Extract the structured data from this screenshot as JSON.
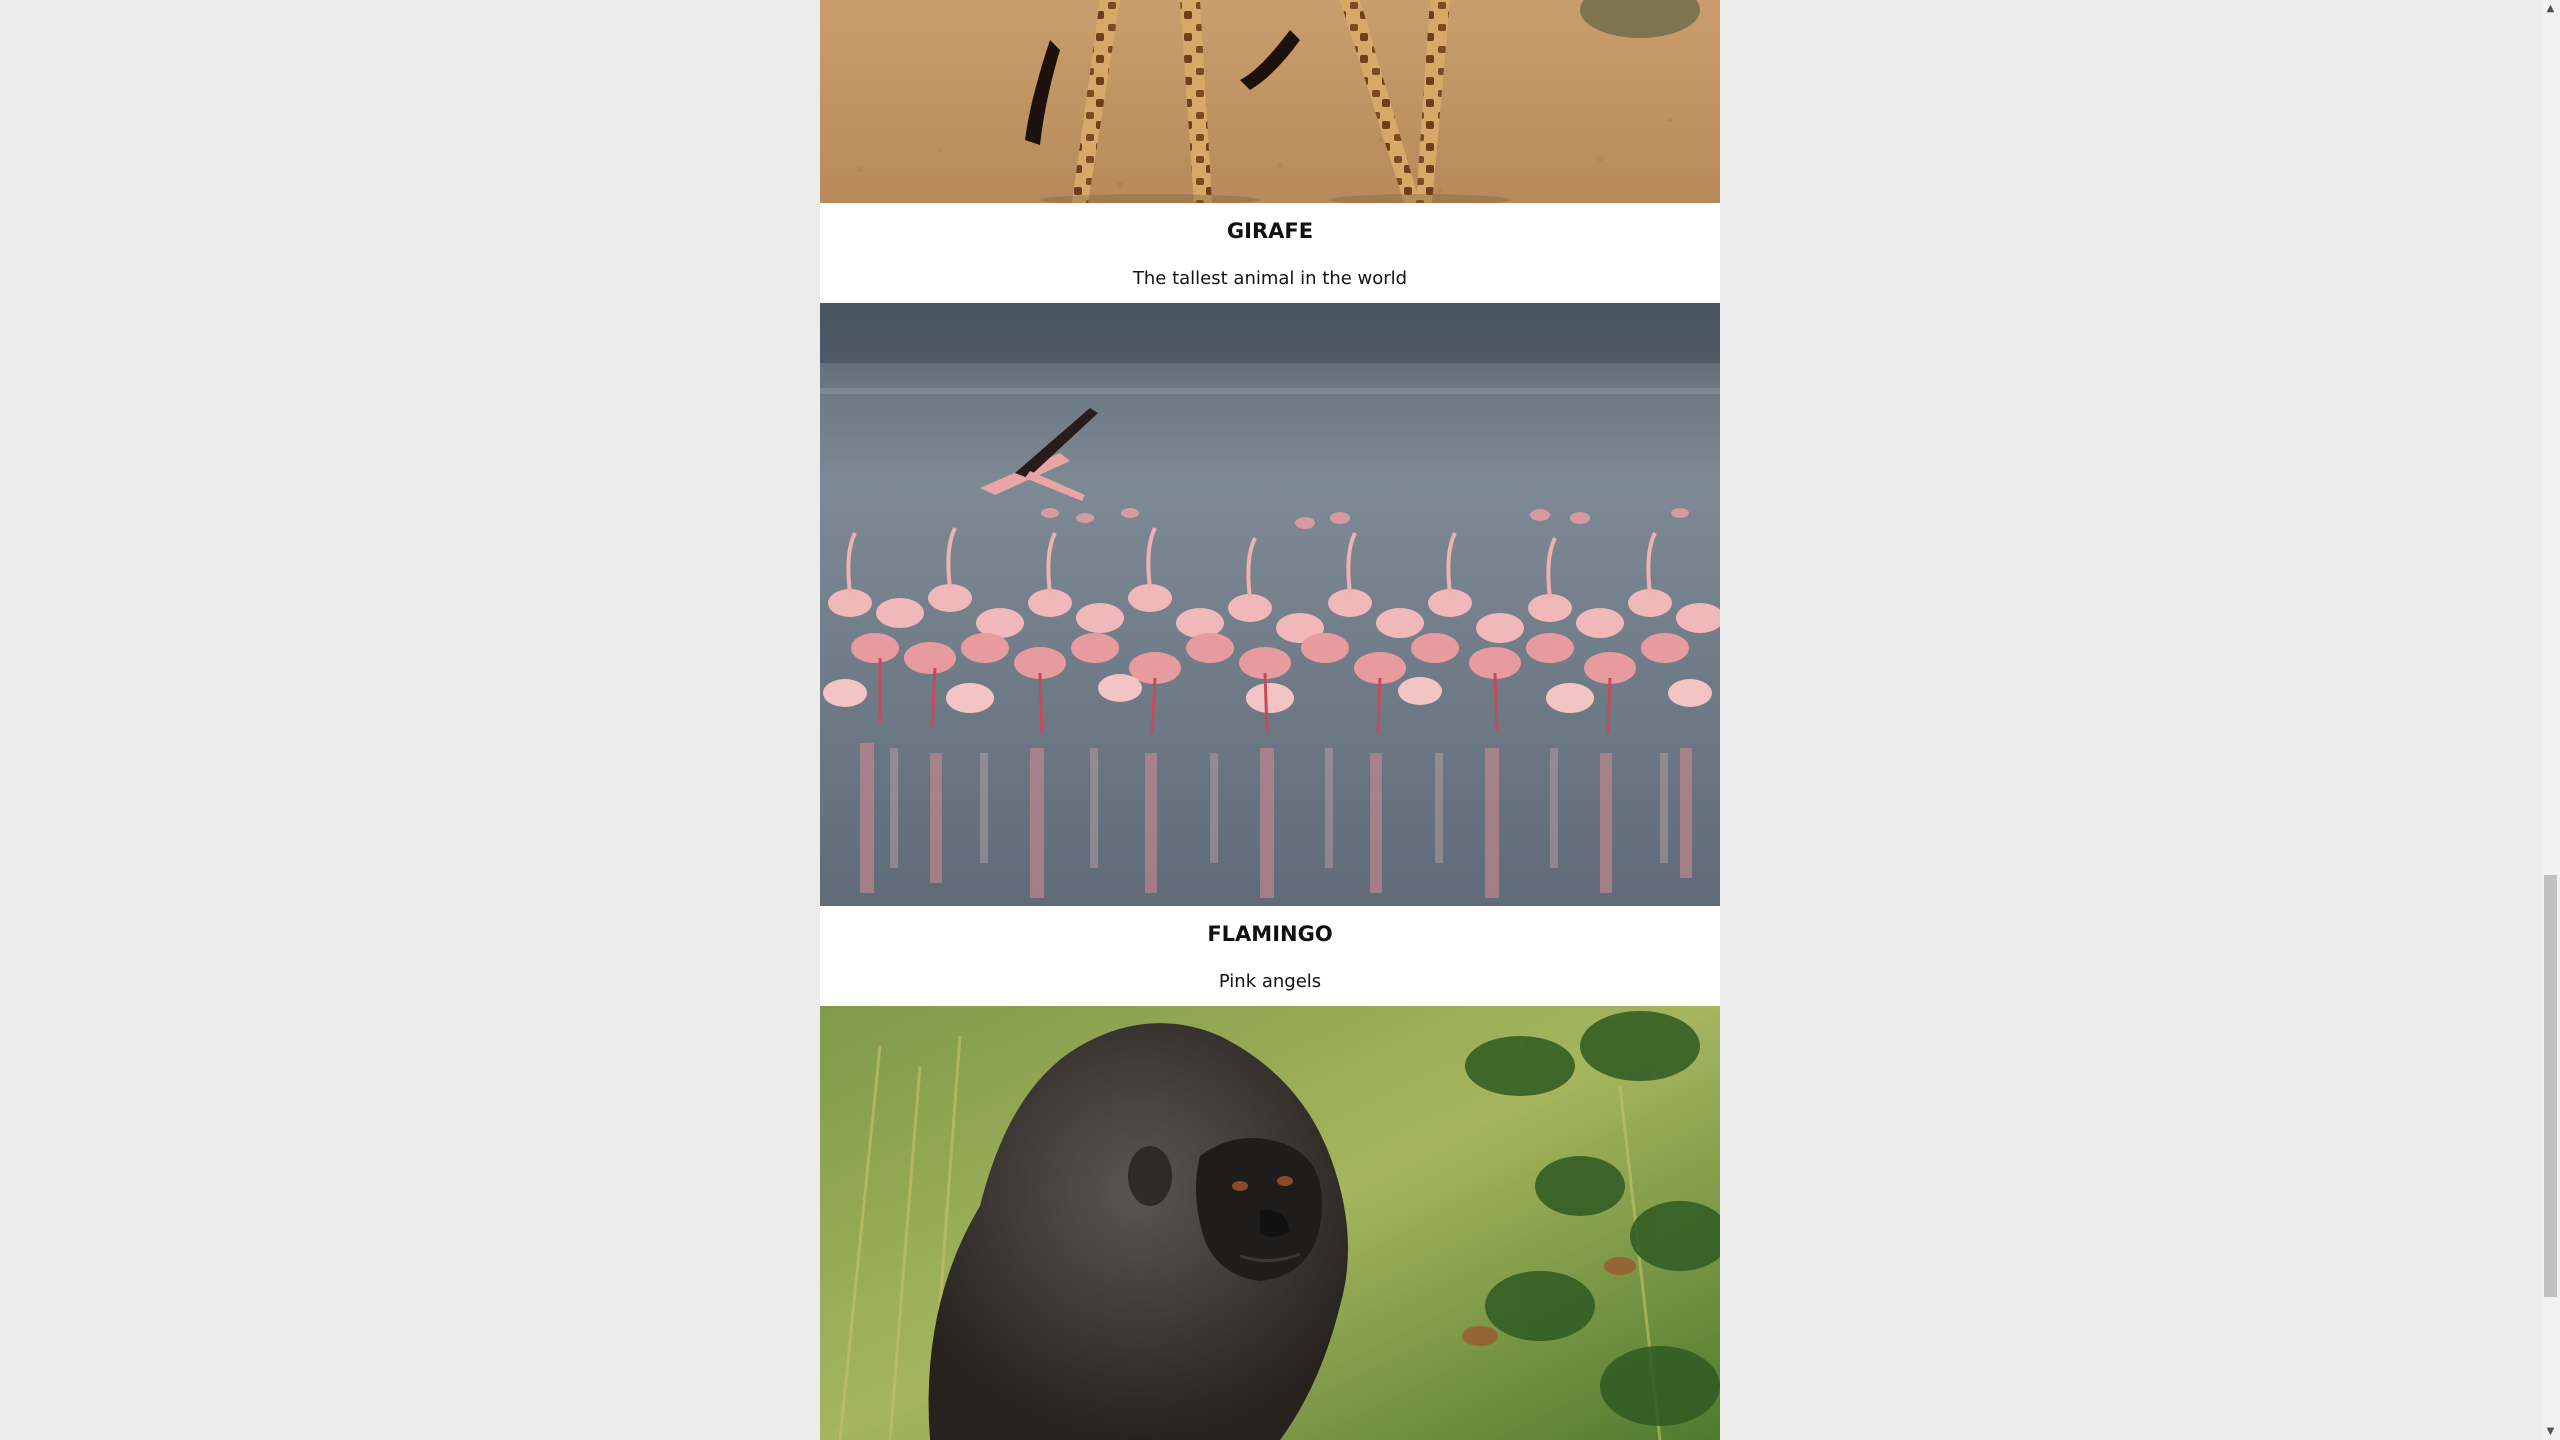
{
  "cards": [
    {
      "name": "GIRAFE",
      "description": "The tallest animal in the world",
      "image_subject": "giraffe legs on savanna"
    },
    {
      "name": "FLAMINGO",
      "description": "Pink angels",
      "image_subject": "flock of flamingos in water"
    },
    {
      "image_subject": "gorilla among foliage"
    }
  ],
  "scrollbar": {
    "up_icon": "▲",
    "down_icon": "▼",
    "position_fraction": 0.61
  }
}
